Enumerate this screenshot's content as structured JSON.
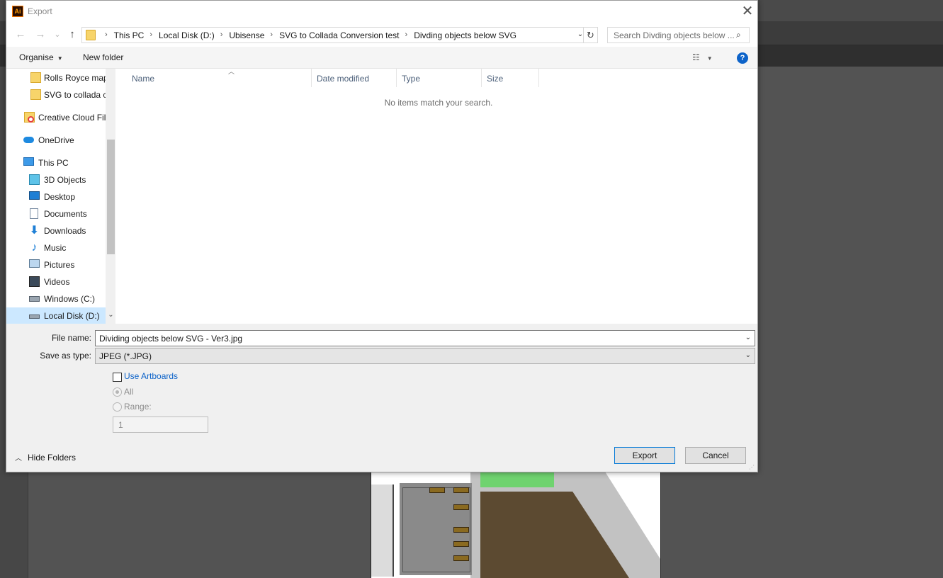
{
  "dialog": {
    "title": "Export",
    "app_icon_text": "Ai",
    "close_glyph": "✕"
  },
  "nav": {
    "back": "←",
    "forward": "→",
    "recent": "⌄",
    "up": "↑",
    "breadcrumbs": [
      "This PC",
      "Local Disk (D:)",
      "Ubisense",
      "SVG to Collada Conversion test",
      "Divding objects below SVG"
    ],
    "search_placeholder": "Search Divding objects below ...",
    "refresh": "↻"
  },
  "commands": {
    "organise": "Organise",
    "new_folder": "New folder",
    "help": "?"
  },
  "sidebar": {
    "items": [
      {
        "label": "Rolls Royce map",
        "icon": "folder-icon"
      },
      {
        "label": "SVG to collada c",
        "icon": "folder-icon"
      },
      {
        "label": "Creative Cloud Fil",
        "icon": "creative-cloud-icon"
      },
      {
        "label": "OneDrive",
        "icon": "cloud-icon"
      },
      {
        "label": "This PC",
        "icon": "computer-icon"
      },
      {
        "label": "3D Objects",
        "icon": "cube-icon"
      },
      {
        "label": "Desktop",
        "icon": "desktop-icon"
      },
      {
        "label": "Documents",
        "icon": "document-icon"
      },
      {
        "label": "Downloads",
        "icon": "download-icon"
      },
      {
        "label": "Music",
        "icon": "music-icon"
      },
      {
        "label": "Pictures",
        "icon": "picture-icon"
      },
      {
        "label": "Videos",
        "icon": "video-icon"
      },
      {
        "label": "Windows (C:)",
        "icon": "drive-icon"
      },
      {
        "label": "Local Disk (D:)",
        "icon": "drive-icon"
      }
    ]
  },
  "files": {
    "columns": [
      "Name",
      "Date modified",
      "Type",
      "Size"
    ],
    "empty_message": "No items match your search."
  },
  "form": {
    "file_name_label": "File name:",
    "file_name_value": "Dividing objects below SVG - Ver3.jpg",
    "save_type_label": "Save as type:",
    "save_type_value": "JPEG (*.JPG)",
    "use_artboards": "Use Artboards",
    "all": "All",
    "range": "Range:",
    "range_value": "1"
  },
  "footer": {
    "hide_folders": "Hide Folders",
    "export": "Export",
    "cancel": "Cancel"
  },
  "colors": {
    "accent": "#0078d7",
    "link": "#0d63c9",
    "selection": "#cce8ff"
  }
}
